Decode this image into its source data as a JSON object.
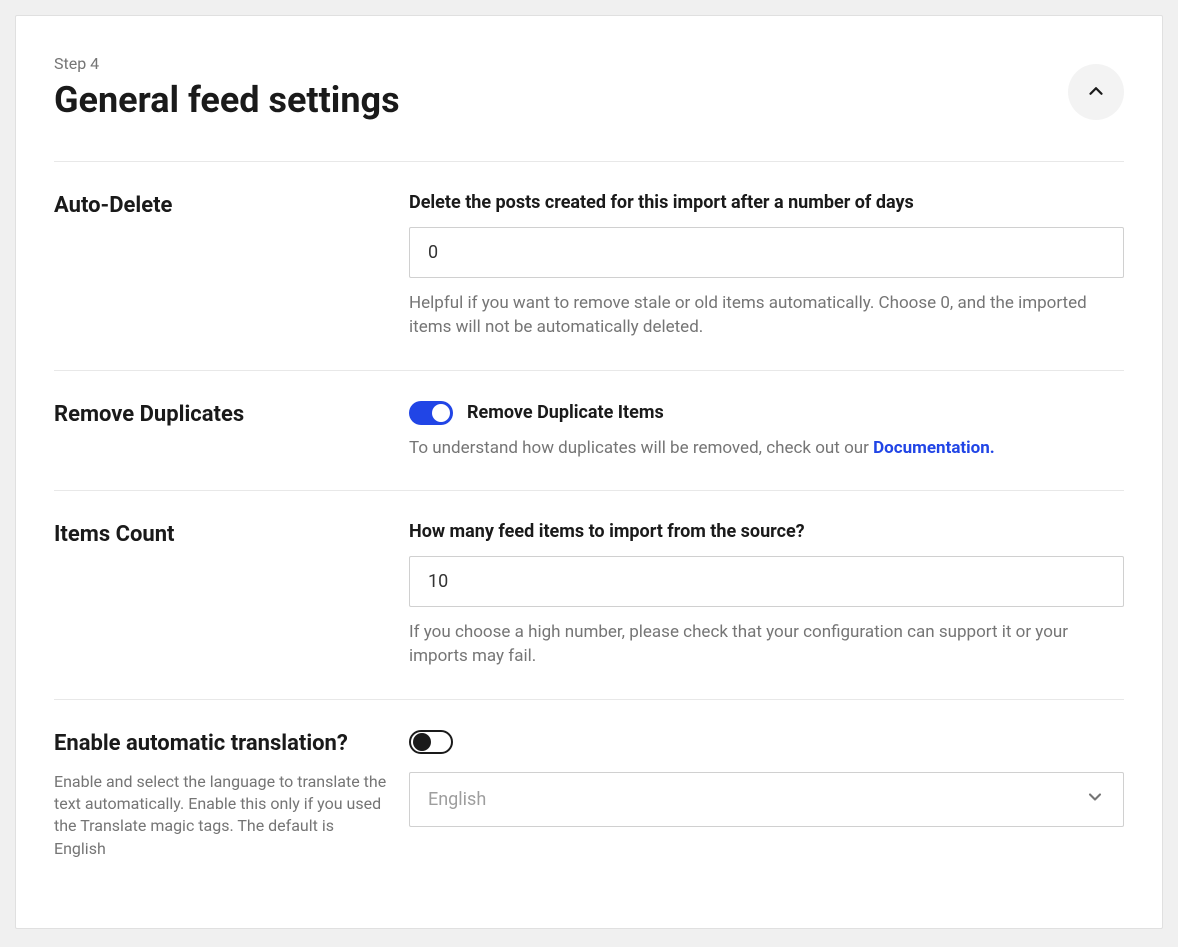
{
  "header": {
    "step": "Step 4",
    "title": "General feed settings"
  },
  "settings": {
    "autoDelete": {
      "label": "Auto-Delete",
      "fieldLabel": "Delete the posts created for this import after a number of days",
      "value": "0",
      "help": "Helpful if you want to remove stale or old items automatically. Choose 0, and the imported items will not be automatically deleted."
    },
    "removeDuplicates": {
      "label": "Remove Duplicates",
      "toggleLabel": "Remove Duplicate Items",
      "helpPrefix": "To understand how duplicates will be removed, check out our ",
      "linkText": "Documentation."
    },
    "itemsCount": {
      "label": "Items Count",
      "fieldLabel": "How many feed items to import from the source?",
      "value": "10",
      "help": "If you choose a high number, please check that your configuration can support it or your imports may fail."
    },
    "autoTranslate": {
      "label": "Enable automatic translation?",
      "sublabel": "Enable and select the language to translate the text automatically. Enable this only if you used the Translate magic tags. The default is English",
      "selected": "English"
    }
  }
}
